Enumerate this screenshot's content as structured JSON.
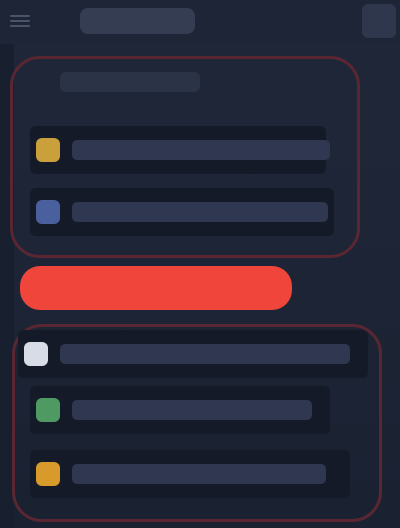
{
  "topbar": {
    "title": "",
    "icons": {
      "menu": "menu-icon",
      "corner": "more-icon"
    }
  },
  "group_a": {
    "header": "",
    "rows": [
      {
        "label": "",
        "icon": "star-icon",
        "color": "#c9a03c"
      },
      {
        "label": "",
        "icon": "info-icon",
        "color": "#4a5f9e"
      }
    ]
  },
  "highlight": {
    "label": "",
    "color": "#f0453a"
  },
  "group_b": {
    "rows": [
      {
        "label": "",
        "icon": "file-icon",
        "color": "#d8dce6"
      },
      {
        "label": "",
        "icon": "check-icon",
        "color": "#4f9a62"
      },
      {
        "label": "",
        "icon": "folder-icon",
        "color": "#d99a2c"
      }
    ]
  },
  "colors": {
    "background": "#1b2334",
    "group_border": "#5a2631",
    "row_background": "#141a27"
  }
}
